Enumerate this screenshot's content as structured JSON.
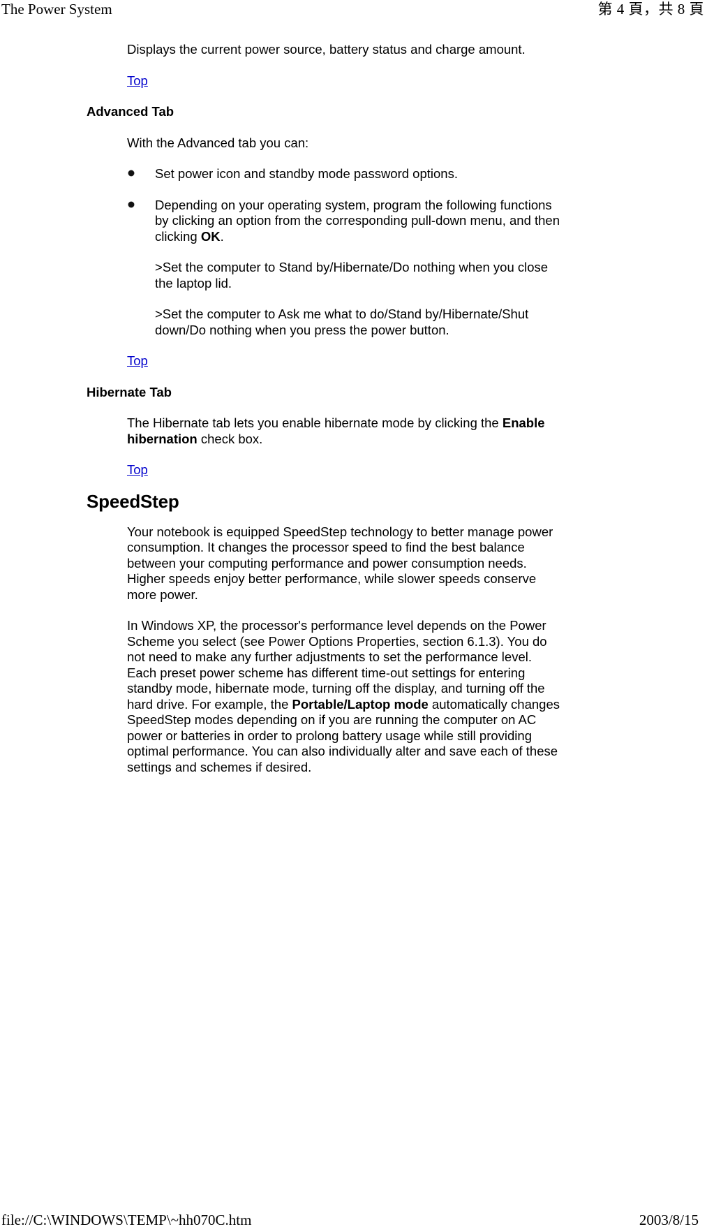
{
  "header": {
    "doc_title": "The Power System",
    "page_indicator": "第 4 頁，共 8 頁"
  },
  "footer": {
    "file_path": "file://C:\\WINDOWS\\TEMP\\~hh070C.htm",
    "date": "2003/8/15"
  },
  "content": {
    "intro_line": "Displays the current power source, battery status and charge amount.",
    "top_link_1": "Top",
    "advanced_tab": {
      "heading": "Advanced Tab",
      "lead": "With the Advanced tab you can:",
      "bullets": [
        {
          "text": "Set power icon and standby mode password options."
        },
        {
          "text_before_bold": "Depending on your operating system, program the following functions by clicking an option from the corresponding pull-down menu, and then clicking ",
          "bold": "OK",
          "text_after_bold": "."
        }
      ],
      "sub_items": [
        ">Set the computer to Stand by/Hibernate/Do nothing when you close the laptop lid.",
        ">Set the computer to Ask me what to do/Stand by/Hibernate/Shut down/Do nothing when you press the power button."
      ],
      "top_link": "Top"
    },
    "hibernate_tab": {
      "heading": "Hibernate Tab",
      "body_before_bold": "The Hibernate tab lets you enable hibernate mode by clicking the ",
      "bold": "Enable hibernation",
      "body_after_bold": " check box.",
      "top_link": "Top"
    },
    "speedstep": {
      "heading": "SpeedStep",
      "paragraph_1": "Your notebook is equipped SpeedStep technology to better manage power consumption. It changes the processor speed to find the best balance between your computing performance and power consumption needs. Higher speeds enjoy better performance, while slower speeds conserve more power.",
      "paragraph_2_before_bold": "In Windows XP, the processor's performance level depends on the Power Scheme you select (see Power Options Properties, section 6.1.3). You do not need to make any further adjustments to set the performance level. Each preset power scheme has different time-out settings for entering standby mode, hibernate mode, turning off the display, and turning off the hard drive. For example, the ",
      "paragraph_2_bold": "Portable/Laptop mode",
      "paragraph_2_after_bold": " automatically changes SpeedStep modes depending on if you are running the computer on AC power or batteries in order to prolong battery usage while still providing optimal performance. You can also individually alter and save each of these settings and schemes if desired."
    }
  },
  "colors": {
    "link": "#0000cc",
    "text": "#000000",
    "background": "#ffffff"
  },
  "icons": {
    "bullet": "bullet-point-icon"
  }
}
